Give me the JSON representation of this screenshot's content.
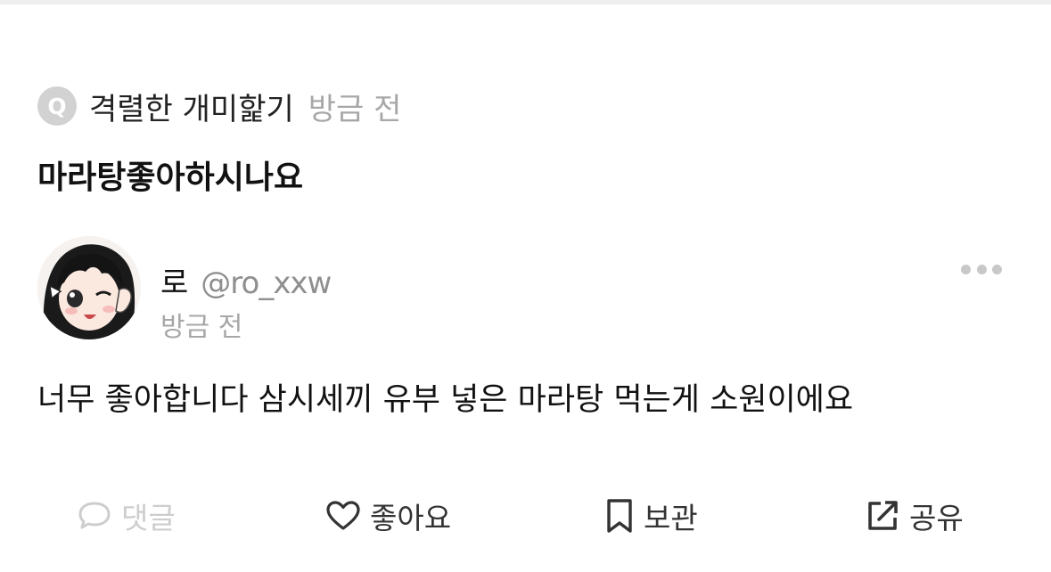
{
  "question": {
    "icon_letter": "Q",
    "author": "격렬한 개미핥기",
    "time": "방금 전",
    "title": "마라탕좋아하시나요"
  },
  "answer": {
    "user_name": "로",
    "user_handle": "@ro_xxw",
    "time": "방금 전",
    "body": "너무 좋아합니다 삼시세끼 유부 넣은 마라탕 먹는게 소원이에요"
  },
  "actions": {
    "comment": {
      "label": "댓글",
      "icon": "comment-bubble-icon"
    },
    "like": {
      "label": "좋아요",
      "icon": "heart-icon"
    },
    "save": {
      "label": "보관",
      "icon": "bookmark-icon"
    },
    "share": {
      "label": "공유",
      "icon": "share-icon"
    }
  },
  "colors": {
    "muted_text": "#a7a7a7",
    "disabled_text": "#cdcdcd",
    "q_badge": "#d2d2d2"
  }
}
